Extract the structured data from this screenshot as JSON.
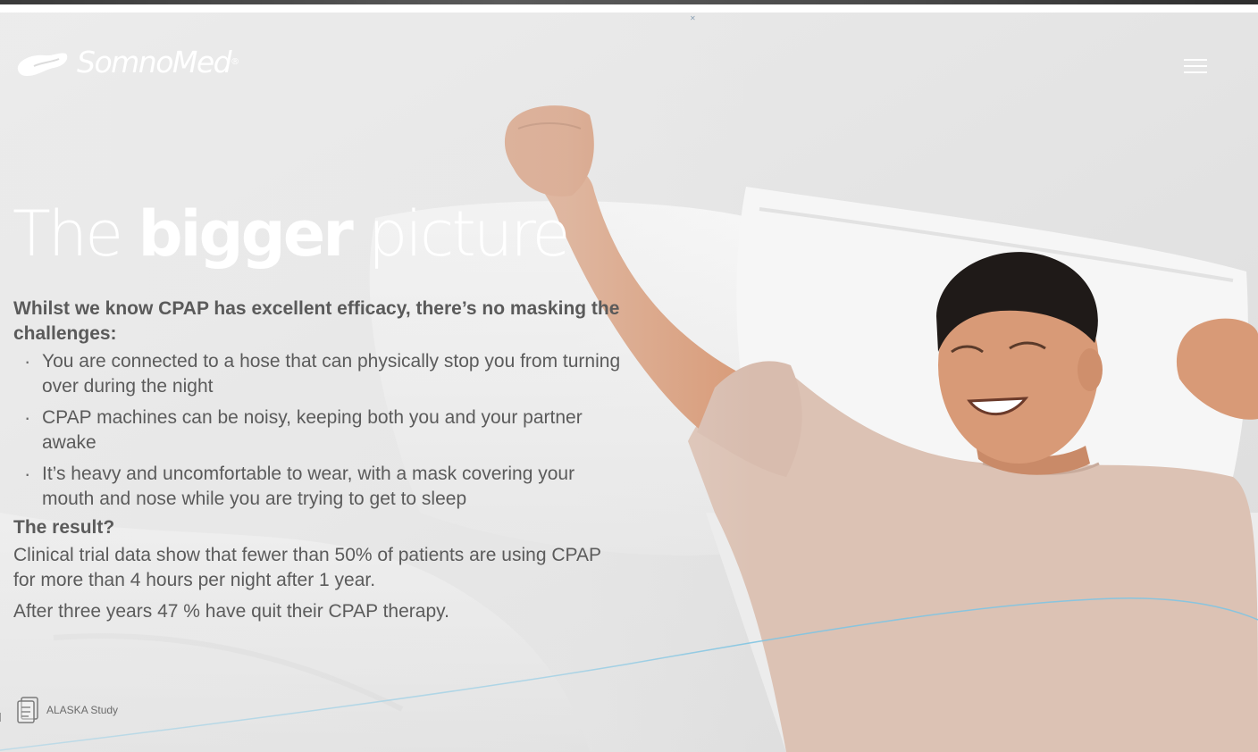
{
  "header": {
    "logo_text": "SomnoMed",
    "logo_mark": "®",
    "menu_icon": "hamburger-menu-icon"
  },
  "hero": {
    "headline_pre": "The ",
    "headline_bold": "bigger",
    "headline_post": " picture",
    "intro": "Whilst we know CPAP has excellent efficacy, there’s no masking the challenges:",
    "challenges": [
      "You are connected to a hose that can physically stop you from turning over during the night",
      "CPAP machines can be noisy, keeping both you and your partner awake",
      "It’s heavy and uncomfortable to wear, with a mask covering your mouth and nose while you are trying to get to sleep"
    ],
    "result_heading": "The result?",
    "result_text": "Clinical trial data show that fewer than 50% of patients are using CPAP for more than 4 hours per night after 1 year.",
    "followup_text": "After three years 47 % have quit their CPAP therapy."
  },
  "citation": {
    "icon": "document-icon",
    "label": "ALASKA Study"
  },
  "colors": {
    "background": "#e9e9e9",
    "text": "#5b5b5b",
    "headline": "#ffffff",
    "wave": "#7fc4e2",
    "shirt": "#dcc2b4",
    "skin": "#d89a77"
  }
}
